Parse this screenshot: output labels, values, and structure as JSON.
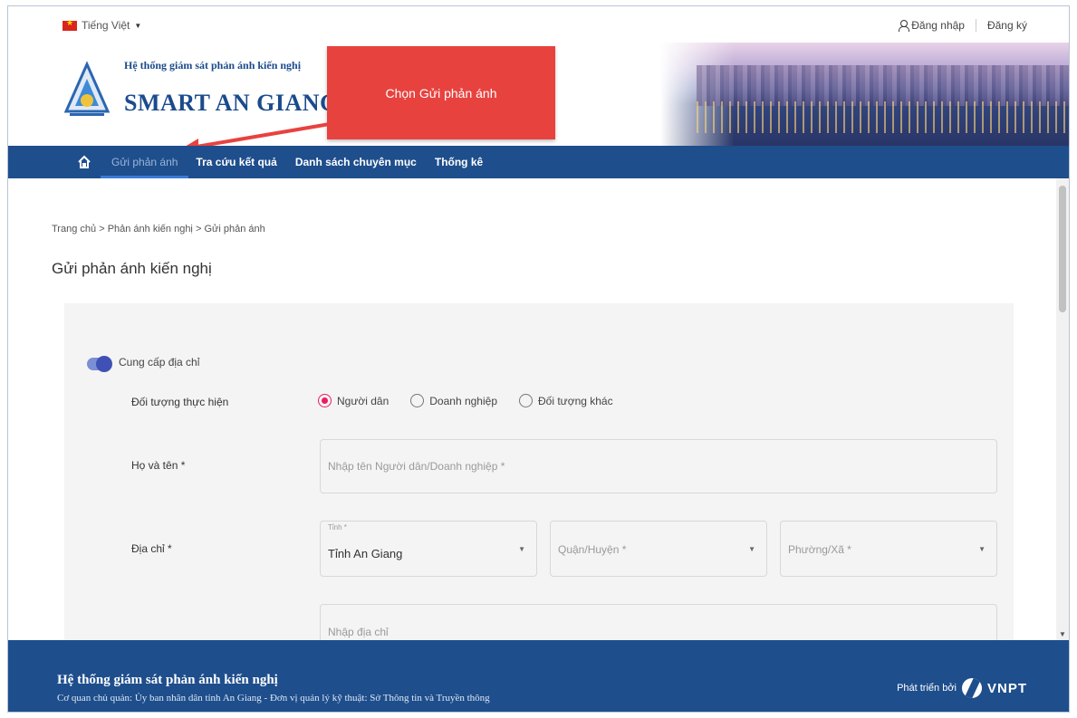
{
  "header": {
    "language": "Tiếng Việt",
    "login": "Đăng nhập",
    "register": "Đăng ký",
    "brand_sub": "Hệ thống giám sát phản ánh kiến nghị",
    "brand_title": "SMART AN GIANG"
  },
  "callout": {
    "text": "Chọn Gửi phản ánh"
  },
  "nav": {
    "items": [
      "Gửi phản ánh",
      "Tra cứu kết quả",
      "Danh sách chuyên mục",
      "Thống kê"
    ]
  },
  "breadcrumb": [
    "Trang chủ",
    "Phản ánh kiến nghị",
    "Gửi phản ánh"
  ],
  "breadcrumb_sep": ">",
  "page_title": "Gửi phản ánh kiến nghị",
  "form": {
    "toggle_label": "Cung cấp địa chỉ",
    "subject_label": "Đối tượng thực hiện",
    "subject_options": [
      "Người dân",
      "Doanh nghiệp",
      "Đối tượng khác"
    ],
    "subject_selected": "Người dân",
    "name_label": "Họ và tên *",
    "name_placeholder": "Nhập tên Người dân/Doanh nghiệp *",
    "address_label": "Địa chỉ *",
    "province_label": "Tỉnh *",
    "province_value": "Tỉnh An Giang",
    "district_placeholder": "Quận/Huyện *",
    "ward_placeholder": "Phường/Xã *",
    "address_placeholder": "Nhập địa chỉ"
  },
  "footer": {
    "title": "Hệ thống giám sát phản ánh kiến nghị",
    "subtitle": "Cơ quan chủ quản: Ủy ban nhân dân tỉnh An Giang - Đơn vị quản lý kỹ thuật: Sở Thông tin và Truyền thông",
    "developed_by": "Phát triển bởi",
    "developer": "VNPT"
  },
  "colors": {
    "nav_bg": "#1e4e8c",
    "brand": "#1a4b8c",
    "callout": "#e8423f",
    "radio_checked": "#e91e63",
    "toggle": "#3f51b5"
  },
  "icons": [
    "flag-vn-icon",
    "caret-down-icon",
    "user-icon",
    "home-icon",
    "chevron-down-icon",
    "vnpt-logo-icon"
  ]
}
